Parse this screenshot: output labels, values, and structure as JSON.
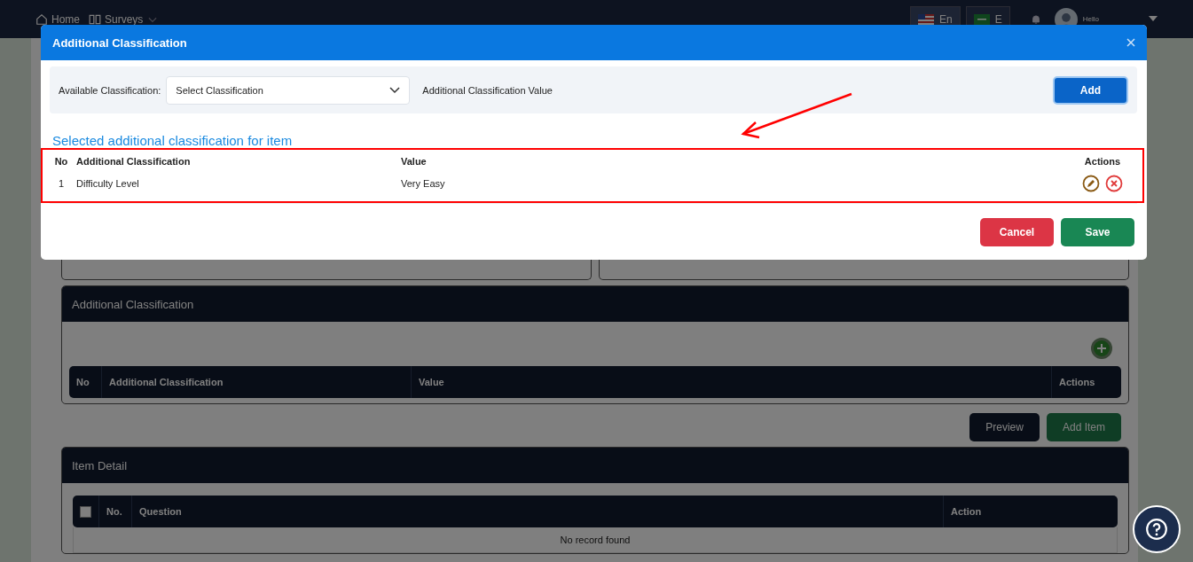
{
  "topbar": {
    "nav": [
      {
        "label": "Home"
      },
      {
        "label": "Surveys"
      }
    ],
    "languages": [
      {
        "label": "En"
      },
      {
        "label": "E"
      }
    ],
    "greeting": "Hello"
  },
  "page": {
    "classification_panel": {
      "title": "Additional Classification",
      "columns": [
        "No",
        "Additional Classification",
        "Value",
        "Actions"
      ]
    },
    "buttons": [
      {
        "label": "Preview",
        "kind": "dark"
      },
      {
        "label": "Add Item",
        "kind": "green"
      }
    ],
    "item_panel": {
      "title": "Item Detail",
      "select_all_checked": false,
      "columns": [
        "No.",
        "Question",
        "Action"
      ],
      "empty_text": "No record found"
    }
  },
  "modal": {
    "title": "Additional Classification",
    "filter_label": "Available Classification:",
    "select_placeholder": "Select Classification",
    "value_label": "Additional Classification Value",
    "add_button": "Add",
    "section_title": "Selected additional classification for item",
    "columns": [
      "No",
      "Additional Classification",
      "Value",
      "Actions"
    ],
    "rows": [
      {
        "no": "1",
        "classification": "Difficulty Level",
        "value": "Very Easy"
      }
    ],
    "footer_buttons": [
      {
        "label": "Cancel",
        "kind": "cancel"
      },
      {
        "label": "Save",
        "kind": "save"
      }
    ]
  }
}
